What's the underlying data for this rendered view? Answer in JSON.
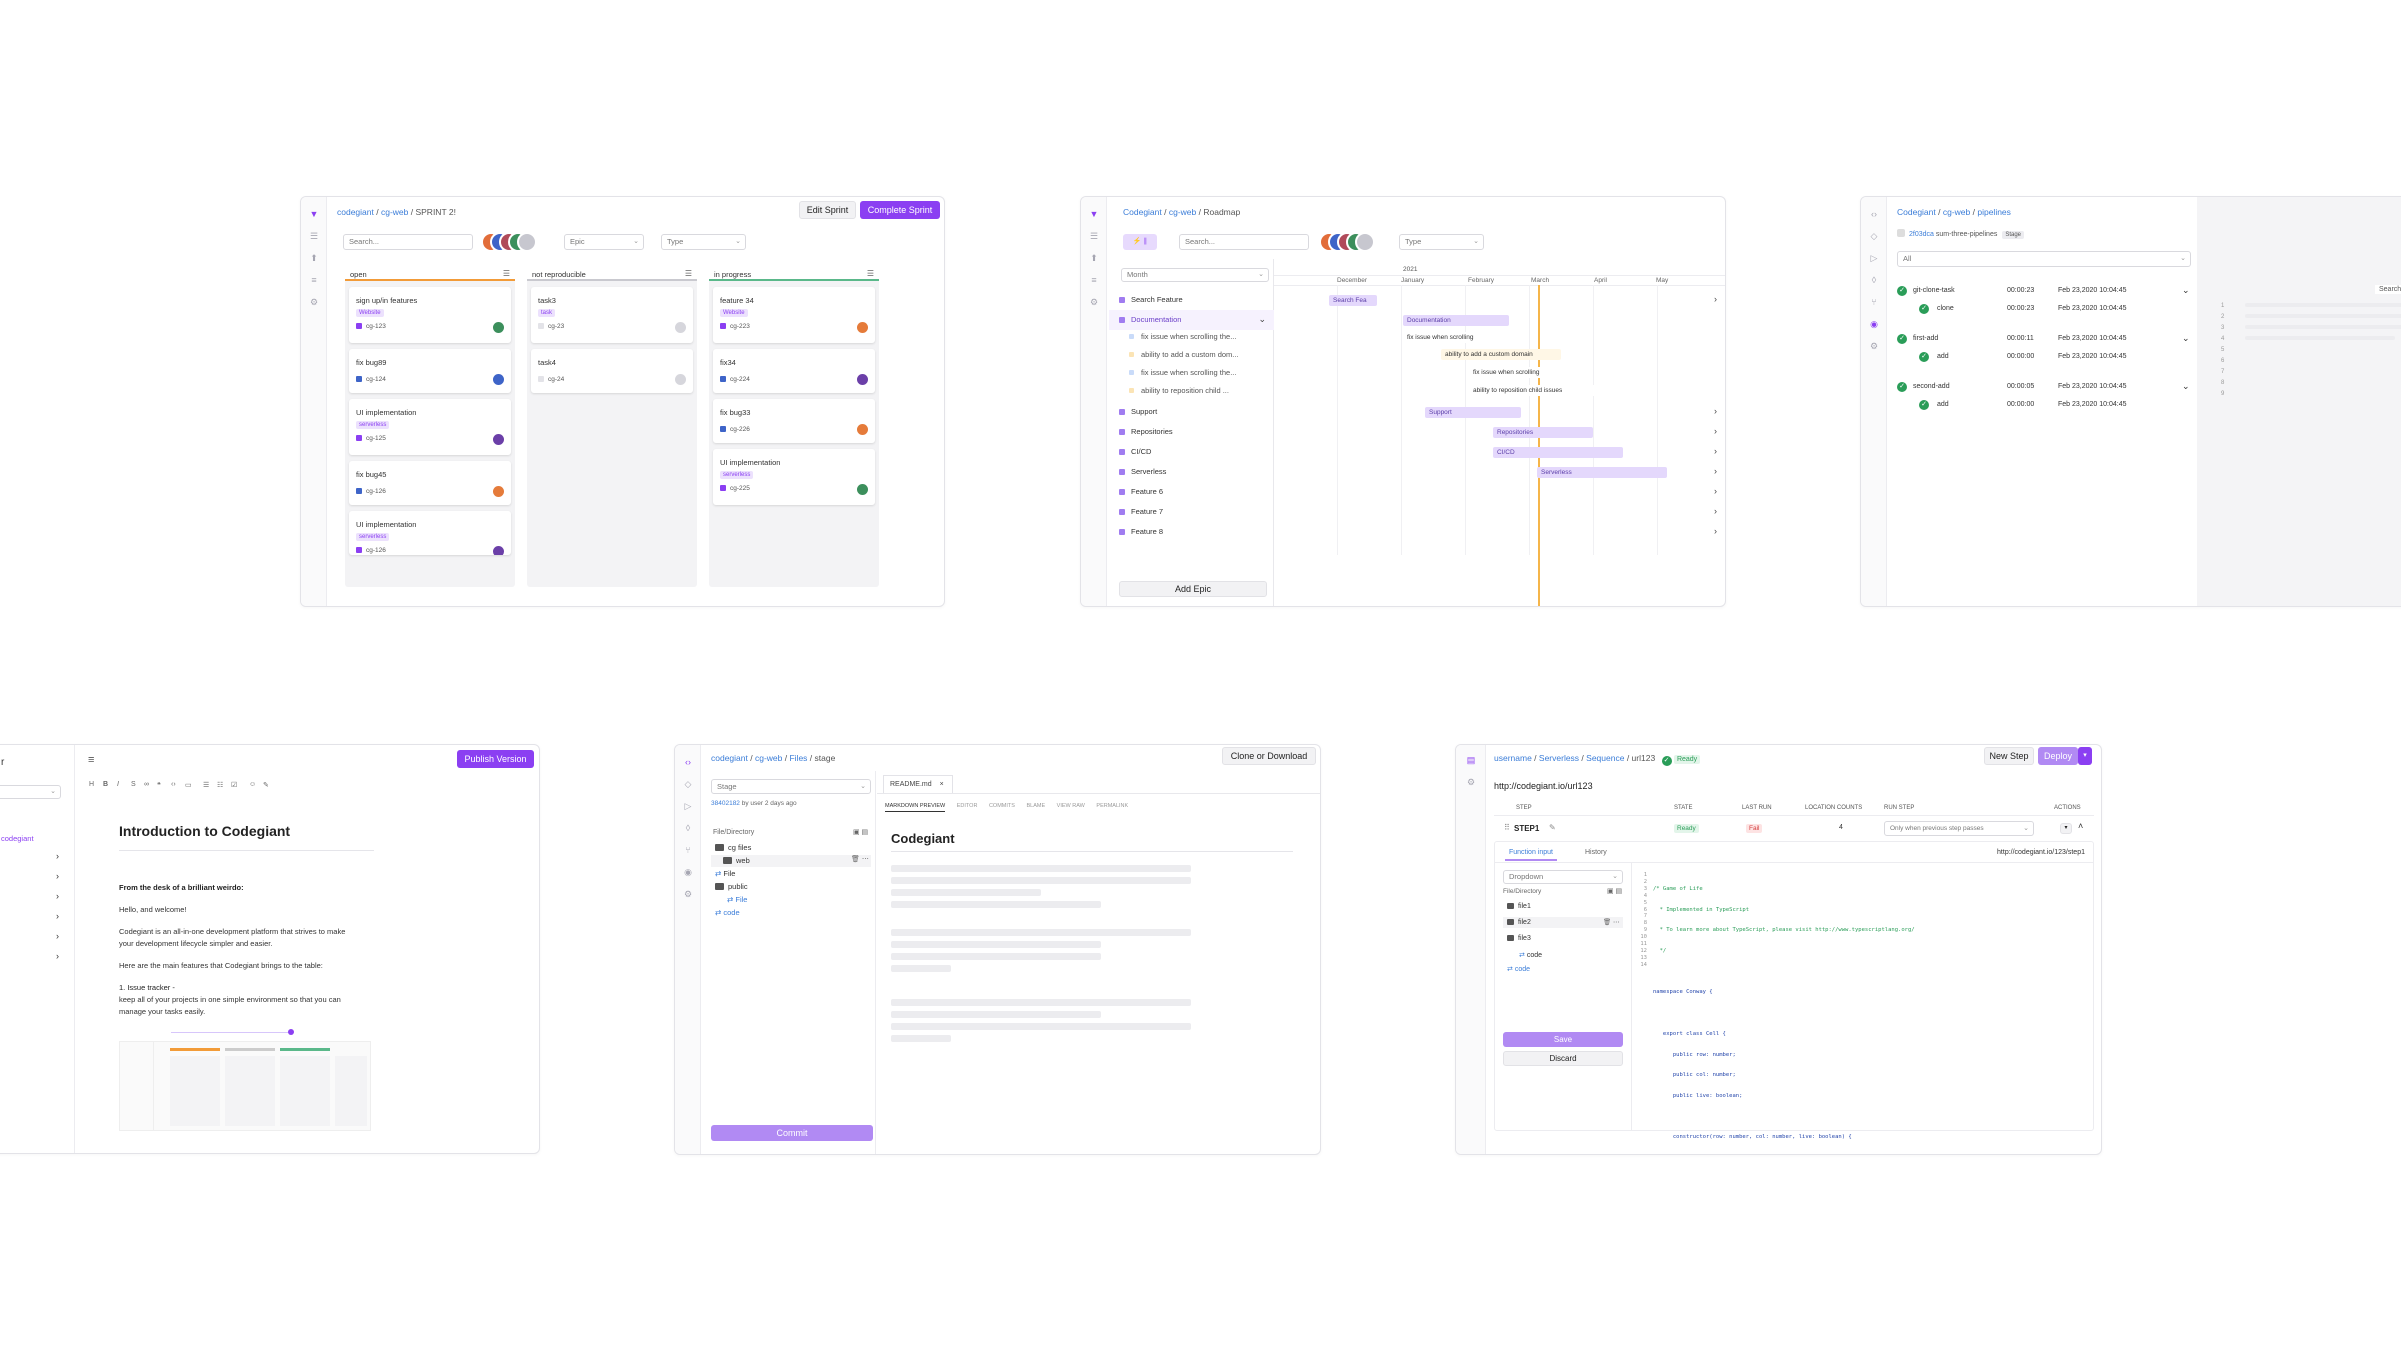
{
  "colors": {
    "accent": "#8b3ff2",
    "link": "#3b7dd8",
    "green": "#2a9d58",
    "orange": "#f29b38"
  },
  "sprint": {
    "breadcrumb": [
      "codegiant",
      "cg-web",
      "SPRINT 2!"
    ],
    "edit_label": "Edit Sprint",
    "complete_label": "Complete Sprint",
    "search_placeholder": "Search...",
    "epic_filter": "Epic",
    "type_filter": "Type",
    "columns": [
      {
        "title": "open",
        "cards": [
          {
            "title": "sign up/in features",
            "tag": "Website",
            "id": "cg-123"
          },
          {
            "title": "fix bug89",
            "id": "cg-124"
          },
          {
            "title": "UI implementation",
            "tag": "serverless",
            "id": "cg-125"
          },
          {
            "title": "fix bug45",
            "id": "cg-126"
          },
          {
            "title": "UI implementation",
            "tag": "serverless",
            "id": "cg-126"
          }
        ]
      },
      {
        "title": "not reproducible",
        "cards": [
          {
            "title": "task3",
            "tag": "task",
            "id": "cg-23"
          },
          {
            "title": "task4",
            "id": "cg-24"
          }
        ]
      },
      {
        "title": "in progress",
        "cards": [
          {
            "title": "feature 34",
            "tag": "Website",
            "id": "cg-223"
          },
          {
            "title": "fix34",
            "id": "cg-224"
          },
          {
            "title": "fix bug33",
            "id": "cg-226"
          },
          {
            "title": "UI implementation",
            "tag": "serverless",
            "id": "cg-225"
          }
        ]
      }
    ]
  },
  "roadmap": {
    "breadcrumb": [
      "Codegiant",
      "cg-web",
      "Roadmap"
    ],
    "search_placeholder": "Search...",
    "type_filter": "Type",
    "month_select": "Month",
    "year": "2021",
    "months": [
      "December",
      "January",
      "February",
      "March",
      "April",
      "May"
    ],
    "epics": [
      "Search Feature",
      "Documentation",
      "fix issue when scrolling the...",
      "ability to add a custom dom...",
      "fix issue when scrolling the...",
      "ability to reposition child ...",
      "Support",
      "Repositories",
      "CI/CD",
      "Serverless",
      "Feature 6",
      "Feature 7",
      "Feature 8"
    ],
    "bars": [
      "Search Fea",
      "Documentation",
      "fix issue when scrolling",
      "ability to add a custom domain",
      "fix issue when scrolling",
      "ability to reposition child issues",
      "Support",
      "Repositories",
      "CI/CD",
      "Serverless"
    ],
    "add_epic": "Add Epic"
  },
  "pipelines": {
    "breadcrumb": [
      "Codegiant",
      "cg-web",
      "pipelines"
    ],
    "commit": "2f03dca",
    "commit_title": "sum-three-pipelines",
    "badge": "Stage",
    "filter": "All",
    "search": "Search",
    "stages": [
      {
        "name": "git-clone-task",
        "time": "00:00:23",
        "date": "Feb 23,2020 10:04:45",
        "step": "clone",
        "step_time": "00:00:23",
        "step_date": "Feb 23,2020 10:04:45"
      },
      {
        "name": "first-add",
        "time": "00:00:11",
        "date": "Feb 23,2020 10:04:45",
        "step": "add",
        "step_time": "00:00:00",
        "step_date": "Feb 23,2020 10:04:45"
      },
      {
        "name": "second-add",
        "time": "00:00:05",
        "date": "Feb 23,2020 10:04:45",
        "step": "add",
        "step_time": "00:00:00",
        "step_date": "Feb 23,2020 10:04:45"
      }
    ],
    "line_numbers": [
      "1",
      "2",
      "3",
      "4",
      "5",
      "6",
      "7",
      "8",
      "9"
    ]
  },
  "docs": {
    "publish_label": "Publish Version",
    "sidebar_link": "codegiant",
    "title": "Introduction to Codegiant",
    "intro": "From the desk of a brilliant weirdo:",
    "p1": "Hello, and welcome!",
    "p2a": "Codegiant is an all-in-one development platform that strives to make",
    "p2b": "your development lifecycle simpler and easier.",
    "p3": "Here are the main features that Codegiant brings to the table:",
    "h1": "1. Issue tracker -",
    "p4a": "keep all of your projects in one simple environment so that you can",
    "p4b": "manage your tasks easily."
  },
  "files": {
    "breadcrumb": [
      "codegiant",
      "cg-web",
      "Files",
      "stage"
    ],
    "clone_label": "Clone or Download",
    "branch": "Stage",
    "commit_hash": "38402182",
    "commit_meta": "by user 2 days ago",
    "file_header": "File/Directory",
    "tree": [
      "cg files",
      "web",
      "File",
      "public",
      "File",
      "code"
    ],
    "tab": "README.md",
    "subtabs": [
      "MARKDOWN PREVIEW",
      "EDITOR",
      "COMMITS",
      "BLAME",
      "VIEW RAW",
      "PERMALINK"
    ],
    "readme_title": "Codegiant",
    "commit_label": "Commit"
  },
  "sequence": {
    "breadcrumb": [
      "username",
      "Serverless",
      "Sequence",
      "url123"
    ],
    "ready_badge": "Ready",
    "new_step": "New Step",
    "deploy": "Deploy",
    "url": "http://codegiant.io/url123",
    "headers": [
      "STEP",
      "STATE",
      "LAST RUN",
      "LOCATION COUNTS",
      "RUN STEP",
      "ACTIONS"
    ],
    "step": {
      "name": "STEP1",
      "state": "Ready",
      "last_run": "Fail",
      "count": "4",
      "run": "Only when previous step passes"
    },
    "tabs": [
      "Function input",
      "History"
    ],
    "step_url": "http://codegiant.io/123/step1",
    "dropdown": "Dropdown",
    "file_header": "File/Directory",
    "tree": [
      "file1",
      "file2",
      "file3",
      "code",
      "code"
    ],
    "save": "Save",
    "discard": "Discard",
    "code": [
      "/* Game of Life",
      "  * Implemented in TypeScript",
      "  * To learn more about TypeScript, please visit http://www.typescriptlang.org/",
      "  */",
      "",
      "namespace Conway {",
      "",
      "   export class Cell {",
      "      public row: number;",
      "      public col: number;",
      "      public live: boolean;",
      "",
      "      constructor(row: number, col: number, live: boolean) {",
      ""
    ]
  }
}
